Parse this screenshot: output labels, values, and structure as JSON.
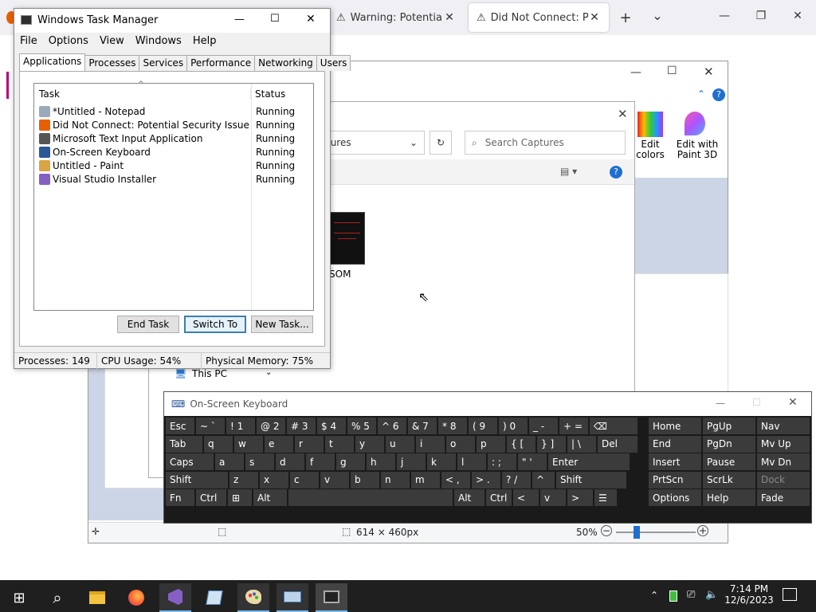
{
  "firefox": {
    "tabs": [
      {
        "title": "Warning: Potential Secu",
        "icon": "warning-icon",
        "active": false
      },
      {
        "title": "Did Not Connect: Poten",
        "icon": "warning-icon",
        "active": true
      }
    ],
    "new_tab": "+",
    "tab_list": "⌄"
  },
  "paint": {
    "ribbon": {
      "edit_colors": "Edit colors",
      "edit_paint3d": "Edit with Paint 3D"
    },
    "status": {
      "size": "614 × 460px",
      "zoom": "50%"
    }
  },
  "explorer": {
    "address": "tures",
    "search_placeholder": "Search Captures",
    "file_label": "SOM",
    "nav_item": "This PC"
  },
  "task_manager": {
    "title": "Windows Task Manager",
    "menu": [
      "File",
      "Options",
      "View",
      "Windows",
      "Help"
    ],
    "tabs": [
      "Applications",
      "Processes",
      "Services",
      "Performance",
      "Networking",
      "Users"
    ],
    "columns": {
      "task": "Task",
      "status": "Status"
    },
    "rows": [
      {
        "task": "*Untitled - Notepad",
        "status": "Running",
        "icon": "notepad-icon",
        "color": "#9ab"
      },
      {
        "task": "Did Not Connect: Potential Security Issue — Moz...",
        "status": "Running",
        "icon": "firefox-icon",
        "color": "#e66000"
      },
      {
        "task": "Microsoft Text Input Application",
        "status": "Running",
        "icon": "text-input-icon",
        "color": "#555"
      },
      {
        "task": "On-Screen Keyboard",
        "status": "Running",
        "icon": "keyboard-icon",
        "color": "#2b5797"
      },
      {
        "task": "Untitled - Paint",
        "status": "Running",
        "icon": "paint-icon",
        "color": "#d9a441"
      },
      {
        "task": "Visual Studio Installer",
        "status": "Running",
        "icon": "visual-studio-icon",
        "color": "#865fc5"
      }
    ],
    "buttons": {
      "end_task": "End Task",
      "switch_to": "Switch To",
      "new_task": "New Task..."
    },
    "status": {
      "processes": "Processes: 149",
      "cpu": "CPU Usage: 54%",
      "memory": "Physical Memory: 75%"
    }
  },
  "osk": {
    "title": "On-Screen Keyboard",
    "rows": [
      [
        [
          "Esc",
          ""
        ],
        [
          "~ `",
          ""
        ],
        [
          "! 1",
          ""
        ],
        [
          "@ 2",
          ""
        ],
        [
          "# 3",
          ""
        ],
        [
          "$ 4",
          ""
        ],
        [
          "% 5",
          ""
        ],
        [
          "^ 6",
          ""
        ],
        [
          "& 7",
          ""
        ],
        [
          "* 8",
          ""
        ],
        [
          "( 9",
          ""
        ],
        [
          ") 0",
          ""
        ],
        [
          "_ -",
          ""
        ],
        [
          "+ =",
          ""
        ],
        [
          "⌫",
          ""
        ]
      ],
      [
        [
          "Tab",
          ""
        ],
        [
          "q",
          ""
        ],
        [
          "w",
          ""
        ],
        [
          "e",
          ""
        ],
        [
          "r",
          ""
        ],
        [
          "t",
          ""
        ],
        [
          "y",
          ""
        ],
        [
          "u",
          ""
        ],
        [
          "i",
          ""
        ],
        [
          "o",
          ""
        ],
        [
          "p",
          ""
        ],
        [
          "{ [",
          ""
        ],
        [
          "} ]",
          ""
        ],
        [
          "| \\",
          ""
        ],
        [
          "Del",
          ""
        ]
      ],
      [
        [
          "Caps",
          ""
        ],
        [
          "a",
          ""
        ],
        [
          "s",
          ""
        ],
        [
          "d",
          ""
        ],
        [
          "f",
          ""
        ],
        [
          "g",
          ""
        ],
        [
          "h",
          ""
        ],
        [
          "j",
          ""
        ],
        [
          "k",
          ""
        ],
        [
          "l",
          ""
        ],
        [
          ": ;",
          ""
        ],
        [
          "\" '",
          ""
        ],
        [
          "Enter",
          ""
        ]
      ],
      [
        [
          "Shift",
          ""
        ],
        [
          "z",
          ""
        ],
        [
          "x",
          ""
        ],
        [
          "c",
          ""
        ],
        [
          "v",
          ""
        ],
        [
          "b",
          ""
        ],
        [
          "n",
          ""
        ],
        [
          "m",
          ""
        ],
        [
          "< ,",
          ""
        ],
        [
          "> .",
          ""
        ],
        [
          "? /",
          ""
        ],
        [
          "^",
          ""
        ],
        [
          "Shift",
          ""
        ]
      ],
      [
        [
          "Fn",
          ""
        ],
        [
          "Ctrl",
          ""
        ],
        [
          "⊞",
          ""
        ],
        [
          "Alt",
          ""
        ],
        [
          "",
          ""
        ],
        [
          "Alt",
          ""
        ],
        [
          "Ctrl",
          ""
        ],
        [
          "<",
          ""
        ],
        [
          "v",
          ""
        ],
        [
          ">",
          ""
        ],
        [
          "☰",
          ""
        ]
      ]
    ],
    "nav": [
      [
        "Home",
        "PgUp",
        "Nav"
      ],
      [
        "End",
        "PgDn",
        "Mv Up"
      ],
      [
        "Insert",
        "Pause",
        "Mv Dn"
      ],
      [
        "PrtScn",
        "ScrLk",
        "Dock"
      ],
      [
        "Options",
        "Help",
        "Fade"
      ]
    ]
  },
  "taskbar": {
    "time": "7:14 PM",
    "date": "12/6/2023"
  }
}
